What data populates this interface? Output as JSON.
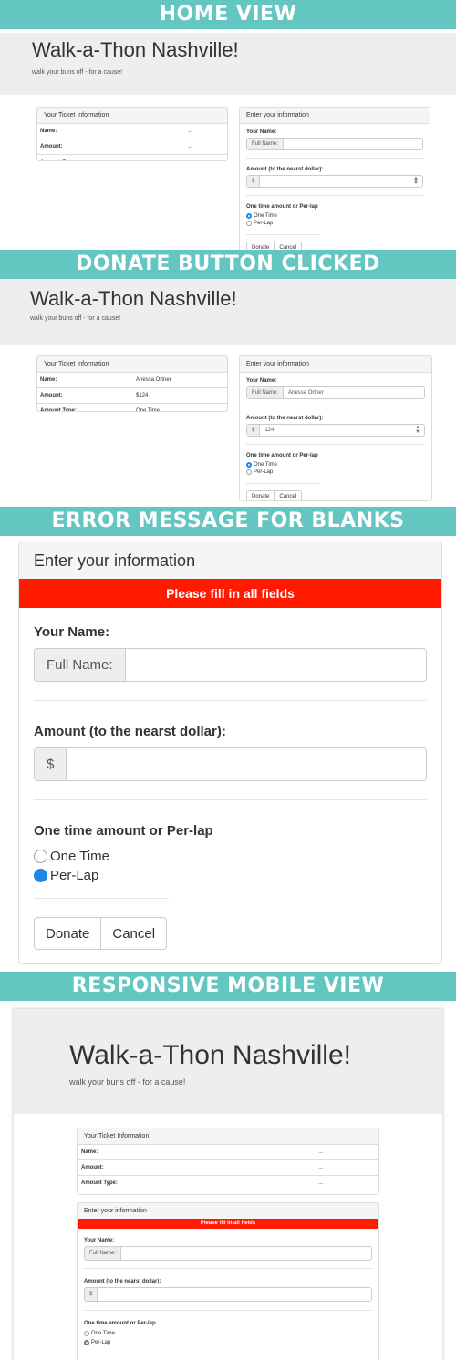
{
  "banners": {
    "home": "HOME VIEW",
    "donate": "DONATE BUTTON CLICKED",
    "error": "ERROR MESSAGE FOR BLANKS",
    "mobile": "RESPONSIVE MOBILE VIEW"
  },
  "app": {
    "title": "Walk-a-Thon Nashville!",
    "tagline": "walk your buns off - for a cause!"
  },
  "ticket": {
    "heading": "Your Ticket Information",
    "labels": {
      "name": "Name:",
      "amount": "Amount:",
      "type": "Amount Type:"
    },
    "empty": {
      "name": "...",
      "amount": "...",
      "type": "..."
    },
    "filled": {
      "name": "Anessa Ortner",
      "amount": "$124",
      "type": "One Time"
    }
  },
  "form": {
    "heading": "Enter your information",
    "name_label": "Your Name:",
    "full_name_addon": "Full Name:",
    "amount_label": "Amount (to the nearst dollar):",
    "dollar_addon": "$",
    "type_label_home": "One time amount or Per-lap",
    "type_label": "One time amount or Per-lap",
    "option_one_time": "One Time",
    "option_per_lap": "Per-Lap",
    "donate": "Donate",
    "cancel": "Cancel",
    "error": "Please fill in all fields",
    "filled": {
      "name": "Anessa Ortner",
      "amount": "124"
    }
  }
}
